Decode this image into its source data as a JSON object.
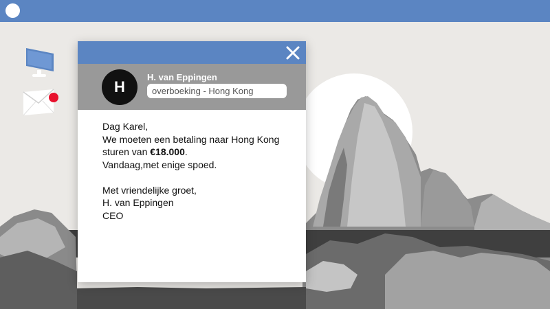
{
  "email": {
    "sender_name": "H. van Eppingen",
    "avatar_initial": "H",
    "subject": "overboeking - Hong Kong",
    "greeting": "Dag Karel,",
    "line1": "We moeten een betaling naar Hong Kong",
    "line2_prefix": "sturen van ",
    "amount": "€18.000",
    "line2_suffix": ".",
    "line3": "Vandaag,met enige spoed.",
    "closing": "Met vriendelijke groet,",
    "signature_name": "H. van Eppingen",
    "signature_title": "CEO"
  },
  "icons": {
    "window_close": "close-icon",
    "desktop_monitor": "monitor-icon",
    "desktop_mail": "mail-icon",
    "notification": "notification-dot"
  },
  "colors": {
    "accent": "#5b85c2",
    "header_gray": "#999999",
    "notification": "#e8112d",
    "background": "#ebe9e6"
  }
}
